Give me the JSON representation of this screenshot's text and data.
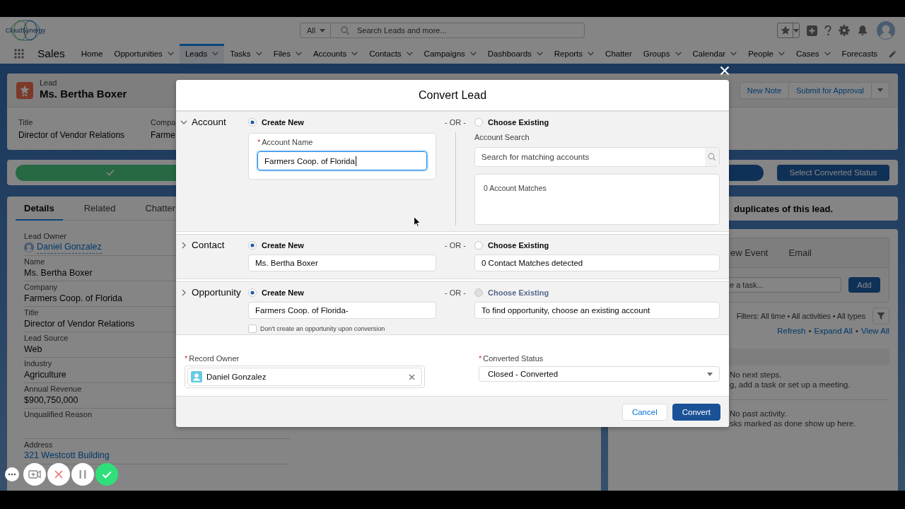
{
  "header": {
    "logo_text": "CloudSynergy",
    "search_scope": "All",
    "search_placeholder": "Search Leads and more..."
  },
  "nav": {
    "app_name": "Sales",
    "items": [
      {
        "label": "Home",
        "has_menu": false,
        "selected": false
      },
      {
        "label": "Opportunities",
        "has_menu": true,
        "selected": false
      },
      {
        "label": "Leads",
        "has_menu": true,
        "selected": true
      },
      {
        "label": "Tasks",
        "has_menu": true,
        "selected": false
      },
      {
        "label": "Files",
        "has_menu": true,
        "selected": false
      },
      {
        "label": "Accounts",
        "has_menu": true,
        "selected": false
      },
      {
        "label": "Contacts",
        "has_menu": true,
        "selected": false
      },
      {
        "label": "Campaigns",
        "has_menu": true,
        "selected": false
      },
      {
        "label": "Dashboards",
        "has_menu": true,
        "selected": false
      },
      {
        "label": "Reports",
        "has_menu": true,
        "selected": false
      },
      {
        "label": "Chatter",
        "has_menu": false,
        "selected": false
      },
      {
        "label": "Groups",
        "has_menu": true,
        "selected": false
      },
      {
        "label": "Calendar",
        "has_menu": true,
        "selected": false
      },
      {
        "label": "People",
        "has_menu": true,
        "selected": false
      },
      {
        "label": "Cases",
        "has_menu": true,
        "selected": false
      },
      {
        "label": "Forecasts",
        "has_menu": false,
        "selected": false
      }
    ]
  },
  "record": {
    "object_type": "Lead",
    "name": "Ms. Bertha Boxer",
    "actions": [
      "New Note",
      "Submit for Approval"
    ],
    "highlight_fields": [
      {
        "label": "Title",
        "value": "Director of Vendor Relations"
      },
      {
        "label": "Compa",
        "value": "Farme"
      }
    ]
  },
  "path": {
    "stages": [
      {
        "kind": "complete"
      },
      {
        "kind": "current"
      }
    ],
    "action": "Select Converted Status"
  },
  "details": {
    "tabs": [
      {
        "label": "Details",
        "selected": true
      },
      {
        "label": "Related",
        "selected": false
      },
      {
        "label": "Chatter",
        "selected": false
      }
    ],
    "fields": [
      {
        "label": "Lead Owner",
        "value": "Daniel Gonzalez",
        "kind": "owner"
      },
      {
        "label": "Name",
        "value": "Ms. Bertha Boxer",
        "kind": "text"
      },
      {
        "label": "Company",
        "value": "Farmers Coop. of Florida",
        "kind": "text"
      },
      {
        "label": "Title",
        "value": "Director of Vendor Relations",
        "kind": "text"
      },
      {
        "label": "Lead Source",
        "value": "Web",
        "kind": "text"
      },
      {
        "label": "Industry",
        "value": "Agriculture",
        "kind": "text"
      },
      {
        "label": "Annual Revenue",
        "value": "$900,750,000",
        "kind": "text"
      },
      {
        "label": "Unqualified Reason",
        "kind": "text"
      },
      {
        "label": "Address",
        "value": "321 Westcott Building",
        "kind": "link"
      }
    ]
  },
  "duplicates": {
    "message": "duplicates of this lead."
  },
  "activity": {
    "tabs": [
      {
        "label": "ew Event",
        "selected": false
      },
      {
        "label": "Email",
        "selected": false
      }
    ],
    "task_placeholder": "e a task...",
    "add_label": "Add",
    "filters": "Filters: All time • All activities • All types",
    "links": [
      "Refresh",
      "Expand All",
      "View All"
    ],
    "link_separator": "•",
    "upcoming": [
      "No next steps.",
      "g, add a task or set up a meeting."
    ],
    "past": [
      "No past activity.",
      "sks marked as done show up here."
    ]
  },
  "modal": {
    "title": "Convert Lead",
    "required_mark": "*",
    "sections": [
      {
        "kind": "account",
        "title": "Account",
        "expanded": true,
        "or_label": "- OR -",
        "create_new": {
          "label": "Create New",
          "selected": true
        },
        "choose_existing": {
          "label": "Choose Existing",
          "selected": false,
          "disabled": false
        },
        "name_label": "Account Name",
        "name_required": true,
        "name_value": "Farmers Coop. of Florida",
        "search_label": "Account Search",
        "search_placeholder": "Search for matching accounts",
        "matches": "0 Account Matches"
      },
      {
        "kind": "contact",
        "title": "Contact",
        "expanded": false,
        "or_label": "- OR -",
        "create_new": {
          "label": "Create New",
          "selected": true
        },
        "choose_existing": {
          "label": "Choose Existing",
          "selected": false,
          "disabled": false
        },
        "name_value": "Ms. Bertha Boxer",
        "existing_text": "0 Contact Matches detected"
      },
      {
        "kind": "opportunity",
        "title": "Opportunity",
        "expanded": false,
        "or_label": "- OR -",
        "create_new": {
          "label": "Create New",
          "selected": true
        },
        "choose_existing": {
          "label": "Choose Existing",
          "selected": false,
          "disabled": true
        },
        "name_value": "Farmers Coop. of Florida-",
        "existing_text": "To find opportunity, choose an existing account",
        "skip_option": {
          "label": "Don't create an opportunity upon conversion",
          "checked": false
        }
      }
    ],
    "owner": {
      "label": "Record Owner",
      "required": true,
      "value": "Daniel Gonzalez"
    },
    "status": {
      "label": "Converted Status",
      "required": true,
      "value": "Closed - Converted"
    },
    "buttons": [
      {
        "label": "Cancel",
        "kind": "neutral"
      },
      {
        "label": "Convert",
        "kind": "brand"
      }
    ]
  }
}
